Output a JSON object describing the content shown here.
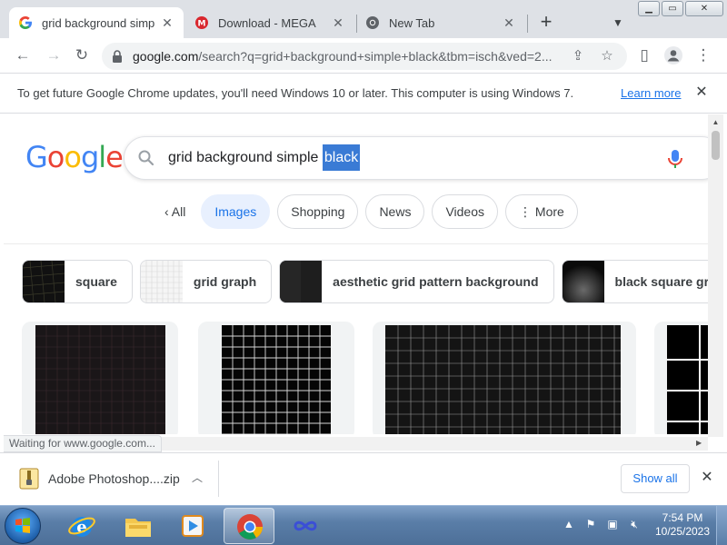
{
  "browser": {
    "tabs": [
      {
        "title": "grid background simple",
        "favicon": "google-g-icon",
        "active": true
      },
      {
        "title": "Download - MEGA",
        "favicon": "mega-icon",
        "active": false
      },
      {
        "title": "New Tab",
        "favicon": "chrome-icon",
        "active": false
      }
    ],
    "new_tab_label": "+",
    "address": {
      "host": "google.com",
      "path": "/search?q=grid+background+simple+black&tbm=isch&ved=2..."
    },
    "infobar": {
      "message": "To get future Google Chrome updates, you'll need Windows 10 or later. This computer is using Windows 7.",
      "link": "Learn more"
    },
    "status_text": "Waiting for www.google.com..."
  },
  "search": {
    "logo": "Google",
    "query_before": "grid background simple ",
    "query_selected": "black",
    "filters": [
      {
        "label": "All",
        "icon": "chevron-left-icon",
        "selected": false
      },
      {
        "label": "Images",
        "selected": true
      },
      {
        "label": "Shopping",
        "selected": false
      },
      {
        "label": "News",
        "selected": false
      },
      {
        "label": "Videos",
        "selected": false
      },
      {
        "label": "More",
        "icon": "more-vert-icon",
        "selected": false
      }
    ],
    "related": [
      {
        "label": "square"
      },
      {
        "label": "grid graph"
      },
      {
        "label": "aesthetic grid pattern background"
      },
      {
        "label": "black square grid"
      }
    ]
  },
  "downloads": {
    "file_name": "Adobe Photoshop....zip",
    "show_all": "Show all"
  },
  "taskbar": {
    "time": "7:54 PM",
    "date": "10/25/2023"
  },
  "colors": {
    "accent": "#1a73e8",
    "selection": "#3a7bd5",
    "taskbar": "#5a7ea8"
  }
}
